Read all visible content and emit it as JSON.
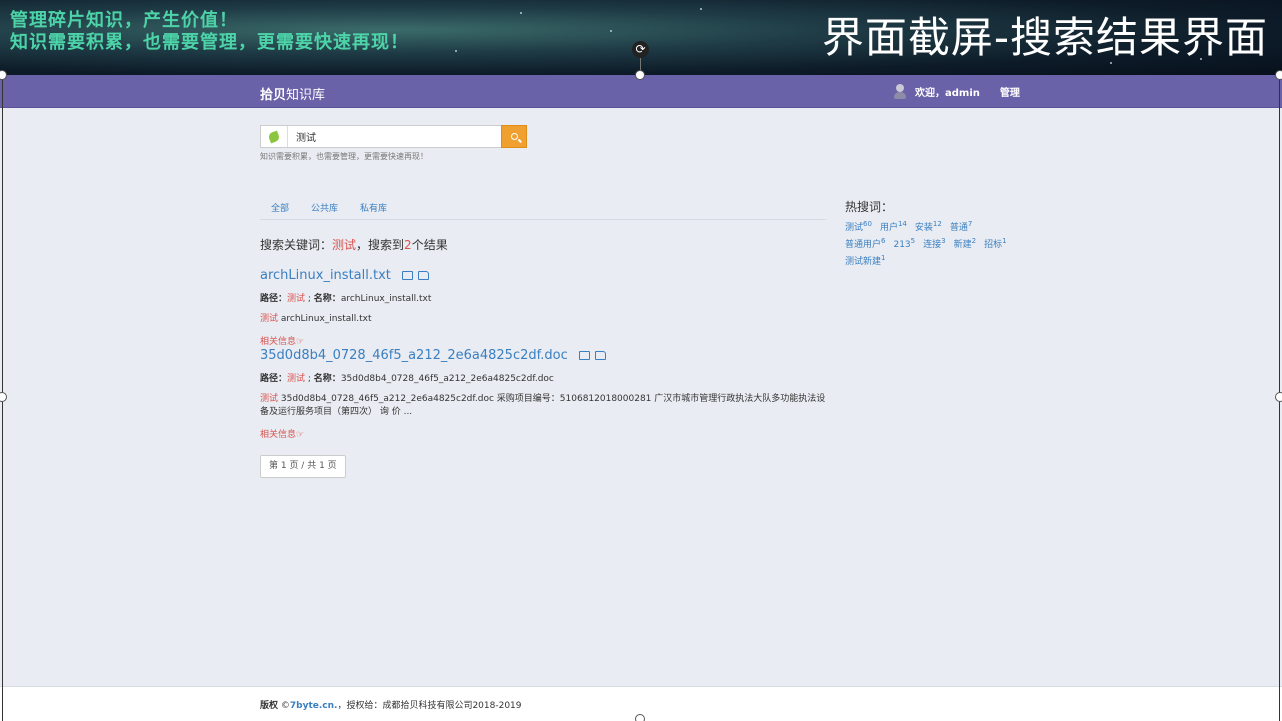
{
  "banner": {
    "slogan_line1": "管理碎片知识，产生价值！",
    "slogan_line2": "知识需要积累，也需要管理，更需要快速再现！",
    "title": "界面截屏-搜索结果界面"
  },
  "navbar": {
    "brand_bold": "拾贝",
    "brand_rest": "知识库",
    "welcome": "欢迎，admin",
    "manage": "管理"
  },
  "search": {
    "value": "测试",
    "hint": "知识需要积累，也需要管理，更需要快速再现！"
  },
  "tabs": [
    "全部",
    "公共库",
    "私有库"
  ],
  "summary": {
    "prefix": "搜索关键词：",
    "keyword": "测试",
    "middle": "，搜索到",
    "count": "2",
    "suffix": "个结果"
  },
  "results": [
    {
      "title": "archLinux_install.txt",
      "path_label": "路径：",
      "path_value": "测试",
      "name_label": "名称：",
      "name_value": "archLinux_install.txt",
      "snippet_keyword": "测试",
      "snippet_text": " archLinux_install.txt",
      "related": "相关信息"
    },
    {
      "title": "35d0d8b4_0728_46f5_a212_2e6a4825c2df.doc",
      "path_label": "路径：",
      "path_value": "测试",
      "name_label": "名称：",
      "name_value": "35d0d8b4_0728_46f5_a212_2e6a4825c2df.doc",
      "snippet_keyword": "测试",
      "snippet_text": " 35d0d8b4_0728_46f5_a212_2e6a4825c2df.doc 采购项目编号：5106812018000281 广汉市城市管理行政执法大队多功能执法设备及运行服务项目（第四次） 询 价 ...",
      "related": "相关信息"
    }
  ],
  "pager": "第 1 页 / 共 1 页",
  "hot_words": {
    "title": "热搜词：",
    "items": [
      {
        "word": "测试",
        "count": "60"
      },
      {
        "word": "用户",
        "count": "14"
      },
      {
        "word": "安装",
        "count": "12"
      },
      {
        "word": "普通",
        "count": "7"
      },
      {
        "word": "普通用户",
        "count": "6"
      },
      {
        "word": "213",
        "count": "5"
      },
      {
        "word": "连接",
        "count": "3"
      },
      {
        "word": "新建",
        "count": "2"
      },
      {
        "word": "招标",
        "count": "1"
      },
      {
        "word": "测试新建",
        "count": "1"
      }
    ]
  },
  "footer": {
    "copyright_label": "版权",
    "copyright_symbol": " ©",
    "site": "7byte.cn.",
    "license": "，授权给：成都拾贝科技有限公司2018-2019"
  },
  "colors": {
    "navbar": "#6a62a8",
    "link": "#3a7fc1",
    "keyword": "#d9534f",
    "search_button": "#f0a030",
    "slogan": "#4cd3a8"
  }
}
